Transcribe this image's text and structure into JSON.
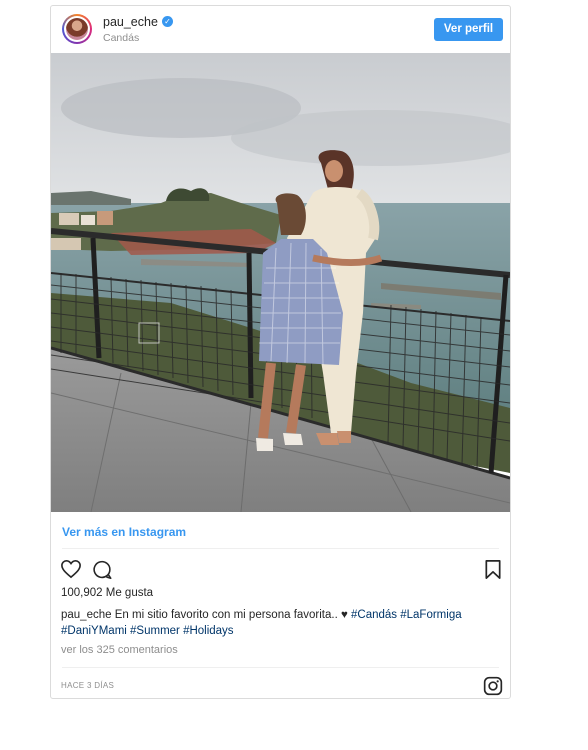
{
  "post": {
    "username": "pau_eche",
    "location": "Candás",
    "profile_button": "Ver perfil",
    "view_more": "Ver más en Instagram",
    "likes": "100,902 Me gusta",
    "caption_user": "pau_eche",
    "caption_text": " En mi sitio favorito con mi persona favorita.. ♥ ",
    "hashtags_line1": "#Candás #LaFormiga",
    "hashtags_line2": "#DaniYMami #Summer #Holidays",
    "comments": "ver los 325 comentarios",
    "time": "HACE 3 DÍAS"
  },
  "colors": {
    "accent": "#3897f0",
    "hashtag": "#003569",
    "muted": "#8e8e8e"
  },
  "icons": [
    "heart-icon",
    "comment-icon",
    "bookmark-icon",
    "instagram-icon",
    "verified-badge-icon"
  ]
}
